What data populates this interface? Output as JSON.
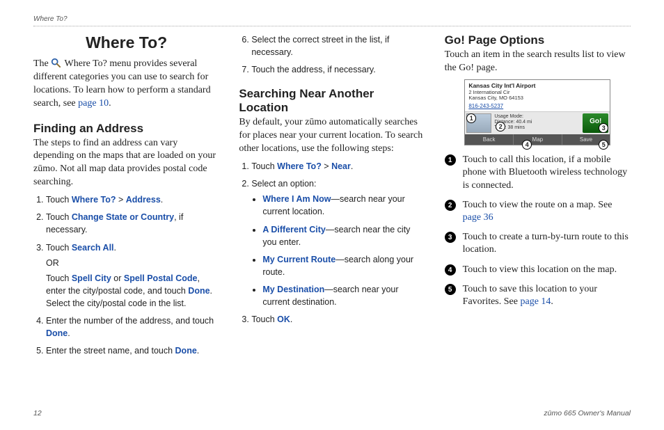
{
  "header": {
    "breadcrumb": "Where To?"
  },
  "title": "Where To?",
  "intro": {
    "pre": "The ",
    "post": " Where To? menu provides several different categories you can use to search for locations. To learn how to perform a standard search, see ",
    "link": "page 10",
    "tail": "."
  },
  "finding": {
    "heading": "Finding an Address",
    "intro": "The steps to find an address can vary depending on the maps that are loaded on your zūmo. Not all map data provides postal code searching.",
    "s1a": "Touch ",
    "s1b": "Where To?",
    "s1c": " > ",
    "s1d": "Address",
    "s1e": ".",
    "s2a": "Touch ",
    "s2b": "Change State or Country",
    "s2c": ", if necessary.",
    "s3a": "Touch ",
    "s3b": "Search All",
    "s3c": ".",
    "or": "OR",
    "s3d": "Touch ",
    "s3e": "Spell City",
    "s3f": " or ",
    "s3g": "Spell Postal Code",
    "s3h": ", enter the city/postal code, and touch ",
    "s3i": "Done",
    "s3j": ". Select the city/postal code in the list.",
    "s4a": "Enter the number of the address, and touch ",
    "s4b": "Done",
    "s4c": ".",
    "s5a": "Enter the street name, and touch ",
    "s5b": "Done",
    "s5c": ".",
    "s6": "Select the correct street in the list, if necessary.",
    "s7": "Touch the address, if necessary."
  },
  "near": {
    "heading": "Searching Near Another Location",
    "intro": "By default, your zūmo automatically searches for places near your current location. To search other locations, use the following steps:",
    "s1a": "Touch ",
    "s1b": "Where To?",
    "s1c": " > ",
    "s1d": "Near",
    "s1e": ".",
    "s2": "Select an option:",
    "b1a": "Where I Am Now",
    "b1b": "—search near your current location.",
    "b2a": "A Different City",
    "b2b": "—search near the city you enter.",
    "b3a": "My Current Route",
    "b3b": "—search along your route.",
    "b4a": "My Destination",
    "b4b": "—search near your current destination.",
    "s3a": "Touch ",
    "s3b": "OK",
    "s3c": "."
  },
  "go": {
    "heading": "Go! Page Options",
    "intro": "Touch an item in the search results list to view the Go! page.",
    "shot": {
      "title": "Kansas City Int'l Airport",
      "addr1": "2 International Cir",
      "addr2": "Kansas City, MO 64153",
      "phone": "816-243-5237",
      "usage": "Usage Mode:",
      "dist": "Distance: 40.4 mi",
      "time": "Time: 38 mins",
      "go": "Go!",
      "back": "Back",
      "map": "Map",
      "save": "Save"
    },
    "n1": "Touch to call this location, if a mobile phone with Bluetooth wireless technology is connected.",
    "n2a": "Touch to view the route on a map. See ",
    "n2b": "page 36",
    "n3": "Touch to create a turn-by-turn route to this location.",
    "n4": "Touch to view this location on the map.",
    "n5a": "Touch to save this location to your Favorites. See ",
    "n5b": "page 14",
    "n5c": "."
  },
  "footer": {
    "page": "12",
    "manual": "zūmo 665 Owner's Manual"
  },
  "callouts": {
    "c1": "1",
    "c2": "2",
    "c3": "3",
    "c4": "4",
    "c5": "5"
  }
}
